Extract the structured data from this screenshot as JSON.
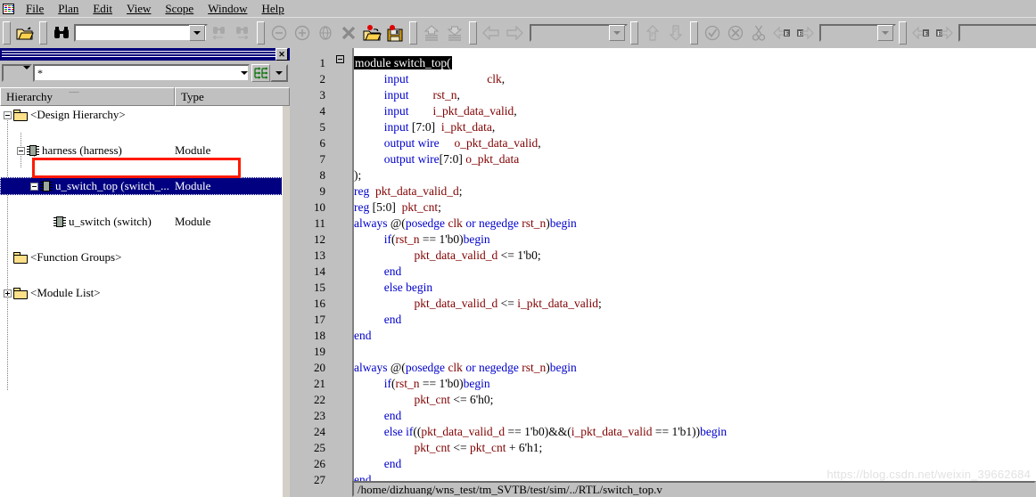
{
  "window": {
    "app_icon": "app-grid-icon"
  },
  "menu": {
    "items": [
      {
        "label": "File",
        "mnemonic": "F"
      },
      {
        "label": "Plan",
        "mnemonic": "P"
      },
      {
        "label": "Edit",
        "mnemonic": "E"
      },
      {
        "label": "View",
        "mnemonic": "V"
      },
      {
        "label": "Scope",
        "mnemonic": "S"
      },
      {
        "label": "Window",
        "mnemonic": "W"
      },
      {
        "label": "Help",
        "mnemonic": "H"
      }
    ]
  },
  "toolbar": {
    "open_icon": "open-folder-icon",
    "find_icon": "binoculars-icon",
    "search_value": "",
    "search_placeholder": "",
    "find_prev_icon": "binoculars-prev-icon",
    "find_next_icon": "binoculars-next-icon",
    "zoom_out_icon": "zoom-out-icon",
    "zoom_in_icon": "zoom-in-icon",
    "globe_icon": "globe-icon",
    "delete_icon": "delete-x-icon",
    "open_db_icon": "open-database-icon",
    "save_db_icon": "save-database-icon",
    "up_stack_icon": "move-up-icon",
    "down_stack_icon": "move-down-icon",
    "back_icon": "back-arrow-icon",
    "forward_icon": "forward-arrow-icon",
    "scope_value": "",
    "port_up_icon": "port-up-icon",
    "port_down_icon": "port-down-icon",
    "check_icon": "check-circle-icon",
    "cancel_icon": "cancel-circle-icon",
    "cut_icon": "scissors-icon",
    "prev_error_icon": "prev-error-icon",
    "next_error_icon": "next-error-icon",
    "signal_value": "",
    "elem_prev_icon": "elem-prev-icon",
    "elem_next_icon": "elem-next-icon",
    "filter_value": "",
    "table_icon": "table-grid-icon"
  },
  "dock": {
    "close_label": "✕",
    "close_icon": "close-icon",
    "filter": {
      "scope_value": "",
      "pattern_value": "*",
      "hierarchy_icon": "hierarchy-flatten-icon"
    },
    "columns": [
      {
        "label": "Hierarchy",
        "sort_icon": "sort-triangle-icon"
      },
      {
        "label": "Type"
      }
    ],
    "tree": [
      {
        "name": "<Design Hierarchy>",
        "type": "",
        "icon": "folder-icon",
        "expander": "minus",
        "depth": 0,
        "selected": false
      },
      {
        "name": "harness (harness)",
        "type": "Module",
        "icon": "module-chip-icon",
        "expander": "minus",
        "depth": 1,
        "selected": false
      },
      {
        "name": "u_switch_top (switch_...",
        "type": "Module",
        "icon": "module-chip-icon",
        "expander": "minus",
        "depth": 2,
        "selected": true
      },
      {
        "name": "u_switch (switch)",
        "type": "Module",
        "icon": "module-chip-icon",
        "expander": "none",
        "depth": 3,
        "selected": false
      },
      {
        "name": "<Function Groups>",
        "type": "",
        "icon": "folder-icon",
        "expander": "none",
        "depth": 0,
        "selected": false
      },
      {
        "name": "<Module List>",
        "type": "",
        "icon": "folder-icon",
        "expander": "plus",
        "depth": 0,
        "selected": false
      }
    ],
    "annotation": {
      "target": "u_switch (switch)",
      "color": "#ff1a00"
    }
  },
  "editor": {
    "highlighted_line": 1,
    "fold_line": 1,
    "lines": [
      {
        "n": 1,
        "tokens": [
          {
            "t": "module switch_top(",
            "c": "hl"
          }
        ]
      },
      {
        "n": 2,
        "tokens": [
          {
            "t": "          ",
            "c": "pl"
          },
          {
            "t": "input",
            "c": "kw"
          },
          {
            "t": "                          ",
            "c": "pl"
          },
          {
            "t": "clk",
            "c": "id"
          },
          {
            "t": ",",
            "c": "pl"
          }
        ]
      },
      {
        "n": 3,
        "tokens": [
          {
            "t": "          ",
            "c": "pl"
          },
          {
            "t": "input",
            "c": "kw"
          },
          {
            "t": "        ",
            "c": "pl"
          },
          {
            "t": "rst_n",
            "c": "id"
          },
          {
            "t": ",",
            "c": "pl"
          }
        ]
      },
      {
        "n": 4,
        "tokens": [
          {
            "t": "          ",
            "c": "pl"
          },
          {
            "t": "input",
            "c": "kw"
          },
          {
            "t": "        ",
            "c": "pl"
          },
          {
            "t": "i_pkt_data_valid",
            "c": "id"
          },
          {
            "t": ",",
            "c": "pl"
          }
        ]
      },
      {
        "n": 5,
        "tokens": [
          {
            "t": "          ",
            "c": "pl"
          },
          {
            "t": "input",
            "c": "kw"
          },
          {
            "t": " [7:0]  ",
            "c": "pl"
          },
          {
            "t": "i_pkt_data",
            "c": "id"
          },
          {
            "t": ",",
            "c": "pl"
          }
        ]
      },
      {
        "n": 6,
        "tokens": [
          {
            "t": "          ",
            "c": "pl"
          },
          {
            "t": "output",
            "c": "kw"
          },
          {
            "t": " ",
            "c": "pl"
          },
          {
            "t": "wire",
            "c": "kw"
          },
          {
            "t": "     ",
            "c": "pl"
          },
          {
            "t": "o_pkt_data_valid",
            "c": "id"
          },
          {
            "t": ",",
            "c": "pl"
          }
        ]
      },
      {
        "n": 7,
        "tokens": [
          {
            "t": "          ",
            "c": "pl"
          },
          {
            "t": "output",
            "c": "kw"
          },
          {
            "t": " ",
            "c": "pl"
          },
          {
            "t": "wire",
            "c": "kw"
          },
          {
            "t": "[7:0] ",
            "c": "pl"
          },
          {
            "t": "o_pkt_data",
            "c": "id"
          }
        ]
      },
      {
        "n": 8,
        "tokens": [
          {
            "t": ");",
            "c": "pl"
          }
        ]
      },
      {
        "n": 9,
        "tokens": [
          {
            "t": "reg",
            "c": "kw"
          },
          {
            "t": "  ",
            "c": "pl"
          },
          {
            "t": "pkt_data_valid_d",
            "c": "id"
          },
          {
            "t": ";",
            "c": "pl"
          }
        ]
      },
      {
        "n": 10,
        "tokens": [
          {
            "t": "reg",
            "c": "kw"
          },
          {
            "t": " [5:0]  ",
            "c": "pl"
          },
          {
            "t": "pkt_cnt",
            "c": "id"
          },
          {
            "t": ";",
            "c": "pl"
          }
        ]
      },
      {
        "n": 11,
        "tokens": [
          {
            "t": "always",
            "c": "kw"
          },
          {
            "t": " @(",
            "c": "pl"
          },
          {
            "t": "posedge",
            "c": "kw"
          },
          {
            "t": " ",
            "c": "pl"
          },
          {
            "t": "clk",
            "c": "id"
          },
          {
            "t": " ",
            "c": "pl"
          },
          {
            "t": "or",
            "c": "kw"
          },
          {
            "t": " ",
            "c": "pl"
          },
          {
            "t": "negedge",
            "c": "kw"
          },
          {
            "t": " ",
            "c": "pl"
          },
          {
            "t": "rst_n",
            "c": "id"
          },
          {
            "t": ")",
            "c": "pl"
          },
          {
            "t": "begin",
            "c": "kw"
          }
        ]
      },
      {
        "n": 12,
        "tokens": [
          {
            "t": "          ",
            "c": "pl"
          },
          {
            "t": "if",
            "c": "kw"
          },
          {
            "t": "(",
            "c": "pl"
          },
          {
            "t": "rst_n",
            "c": "id"
          },
          {
            "t": " == 1'b0)",
            "c": "pl"
          },
          {
            "t": "begin",
            "c": "kw"
          }
        ]
      },
      {
        "n": 13,
        "tokens": [
          {
            "t": "                    ",
            "c": "pl"
          },
          {
            "t": "pkt_data_valid_d",
            "c": "id"
          },
          {
            "t": " <= 1'b0;",
            "c": "pl"
          }
        ]
      },
      {
        "n": 14,
        "tokens": [
          {
            "t": "          ",
            "c": "pl"
          },
          {
            "t": "end",
            "c": "kw"
          }
        ]
      },
      {
        "n": 15,
        "tokens": [
          {
            "t": "          ",
            "c": "pl"
          },
          {
            "t": "else begin",
            "c": "kw"
          }
        ]
      },
      {
        "n": 16,
        "tokens": [
          {
            "t": "                    ",
            "c": "pl"
          },
          {
            "t": "pkt_data_valid_d",
            "c": "id"
          },
          {
            "t": " <= ",
            "c": "pl"
          },
          {
            "t": "i_pkt_data_valid",
            "c": "id"
          },
          {
            "t": ";",
            "c": "pl"
          }
        ]
      },
      {
        "n": 17,
        "tokens": [
          {
            "t": "          ",
            "c": "pl"
          },
          {
            "t": "end",
            "c": "kw"
          }
        ]
      },
      {
        "n": 18,
        "tokens": [
          {
            "t": "end",
            "c": "kw"
          }
        ]
      },
      {
        "n": 19,
        "tokens": []
      },
      {
        "n": 20,
        "tokens": [
          {
            "t": "always",
            "c": "kw"
          },
          {
            "t": " @(",
            "c": "pl"
          },
          {
            "t": "posedge",
            "c": "kw"
          },
          {
            "t": " ",
            "c": "pl"
          },
          {
            "t": "clk",
            "c": "id"
          },
          {
            "t": " ",
            "c": "pl"
          },
          {
            "t": "or",
            "c": "kw"
          },
          {
            "t": " ",
            "c": "pl"
          },
          {
            "t": "negedge",
            "c": "kw"
          },
          {
            "t": " ",
            "c": "pl"
          },
          {
            "t": "rst_n",
            "c": "id"
          },
          {
            "t": ")",
            "c": "pl"
          },
          {
            "t": "begin",
            "c": "kw"
          }
        ]
      },
      {
        "n": 21,
        "tokens": [
          {
            "t": "          ",
            "c": "pl"
          },
          {
            "t": "if",
            "c": "kw"
          },
          {
            "t": "(",
            "c": "pl"
          },
          {
            "t": "rst_n",
            "c": "id"
          },
          {
            "t": " == 1'b0)",
            "c": "pl"
          },
          {
            "t": "begin",
            "c": "kw"
          }
        ]
      },
      {
        "n": 22,
        "tokens": [
          {
            "t": "                    ",
            "c": "pl"
          },
          {
            "t": "pkt_cnt",
            "c": "id"
          },
          {
            "t": " <= 6'h0;",
            "c": "pl"
          }
        ]
      },
      {
        "n": 23,
        "tokens": [
          {
            "t": "          ",
            "c": "pl"
          },
          {
            "t": "end",
            "c": "kw"
          }
        ]
      },
      {
        "n": 24,
        "tokens": [
          {
            "t": "          ",
            "c": "pl"
          },
          {
            "t": "else",
            "c": "kw"
          },
          {
            "t": " ",
            "c": "pl"
          },
          {
            "t": "if",
            "c": "kw"
          },
          {
            "t": "((",
            "c": "pl"
          },
          {
            "t": "pkt_data_valid_d",
            "c": "id"
          },
          {
            "t": " == 1'b0)&&(",
            "c": "pl"
          },
          {
            "t": "i_pkt_data_valid",
            "c": "id"
          },
          {
            "t": " == 1'b1))",
            "c": "pl"
          },
          {
            "t": "begin",
            "c": "kw"
          }
        ]
      },
      {
        "n": 25,
        "tokens": [
          {
            "t": "                    ",
            "c": "pl"
          },
          {
            "t": "pkt_cnt",
            "c": "id"
          },
          {
            "t": " <= ",
            "c": "pl"
          },
          {
            "t": "pkt_cnt",
            "c": "id"
          },
          {
            "t": " + 6'h1;",
            "c": "pl"
          }
        ]
      },
      {
        "n": 26,
        "tokens": [
          {
            "t": "          ",
            "c": "pl"
          },
          {
            "t": "end",
            "c": "kw"
          }
        ]
      },
      {
        "n": 27,
        "tokens": [
          {
            "t": "end",
            "c": "kw"
          }
        ]
      }
    ],
    "status_path": "/home/dizhuang/wns_test/tm_SVTB/test/sim/../RTL/switch_top.v"
  },
  "watermark": {
    "text": "https://blog.csdn.net/weixin_39662684"
  },
  "colors": {
    "keyword": "#0000cc",
    "identifier": "#800000",
    "selection": "#000080",
    "annotation": "#ff1a00",
    "titlebar": "#00007b",
    "chrome": "#c0c0c0"
  }
}
